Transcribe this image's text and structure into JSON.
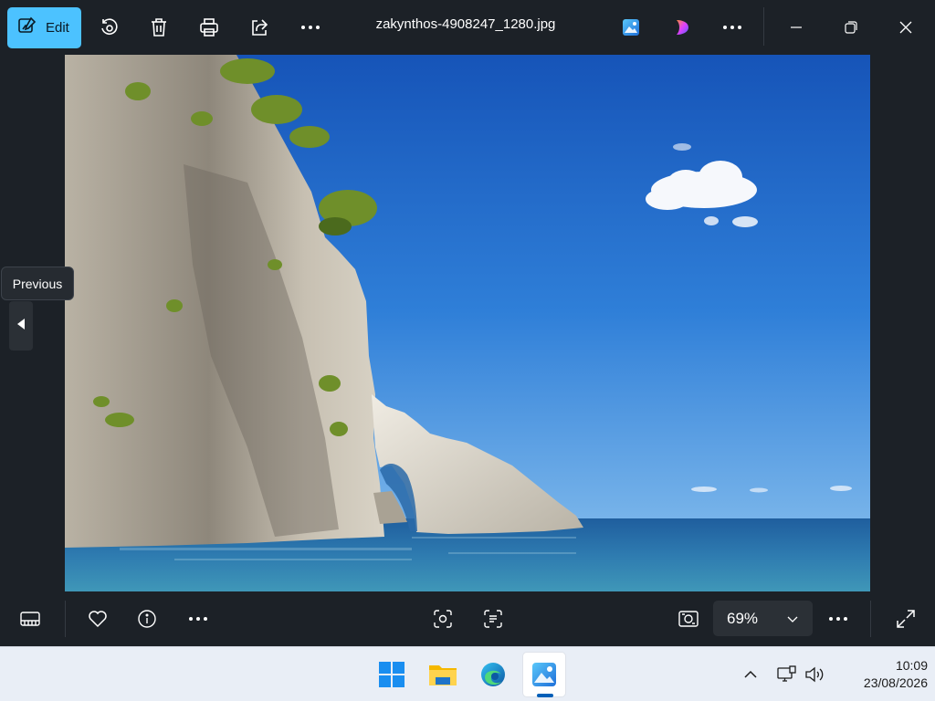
{
  "toolbar": {
    "edit_label": "Edit",
    "icons": [
      "edit-icon",
      "rotate-icon",
      "delete-icon",
      "print-icon",
      "share-icon",
      "more-icon"
    ],
    "filename": "zakynthos-4908247_1280.jpg",
    "right_icons": [
      "photos-app-icon",
      "clipchamp-icon",
      "more-icon"
    ],
    "window_controls": [
      "minimize-icon",
      "restore-icon",
      "close-icon"
    ]
  },
  "viewer": {
    "previous_tooltip": "Previous"
  },
  "bottom_toolbar": {
    "icons": [
      "filmstrip-icon",
      "favorite-icon",
      "info-icon",
      "more-icon",
      "visual-search-icon",
      "text-scan-icon",
      "actual-size-icon",
      "more-icon",
      "fullscreen-icon"
    ],
    "zoom_label": "69%"
  },
  "taskbar": {
    "apps": [
      "start-icon",
      "file-explorer-icon",
      "edge-icon",
      "photos-icon"
    ],
    "active_app": "photos-icon",
    "tray": [
      "show-hidden-icons",
      "network-icon",
      "volume-icon"
    ],
    "time": "10:09",
    "date": "23/08/2026"
  },
  "colors": {
    "accent": "#4cc2ff",
    "background": "#1c2127",
    "taskbar": "#e9eef6",
    "taskbar_indicator": "#005fb8"
  }
}
